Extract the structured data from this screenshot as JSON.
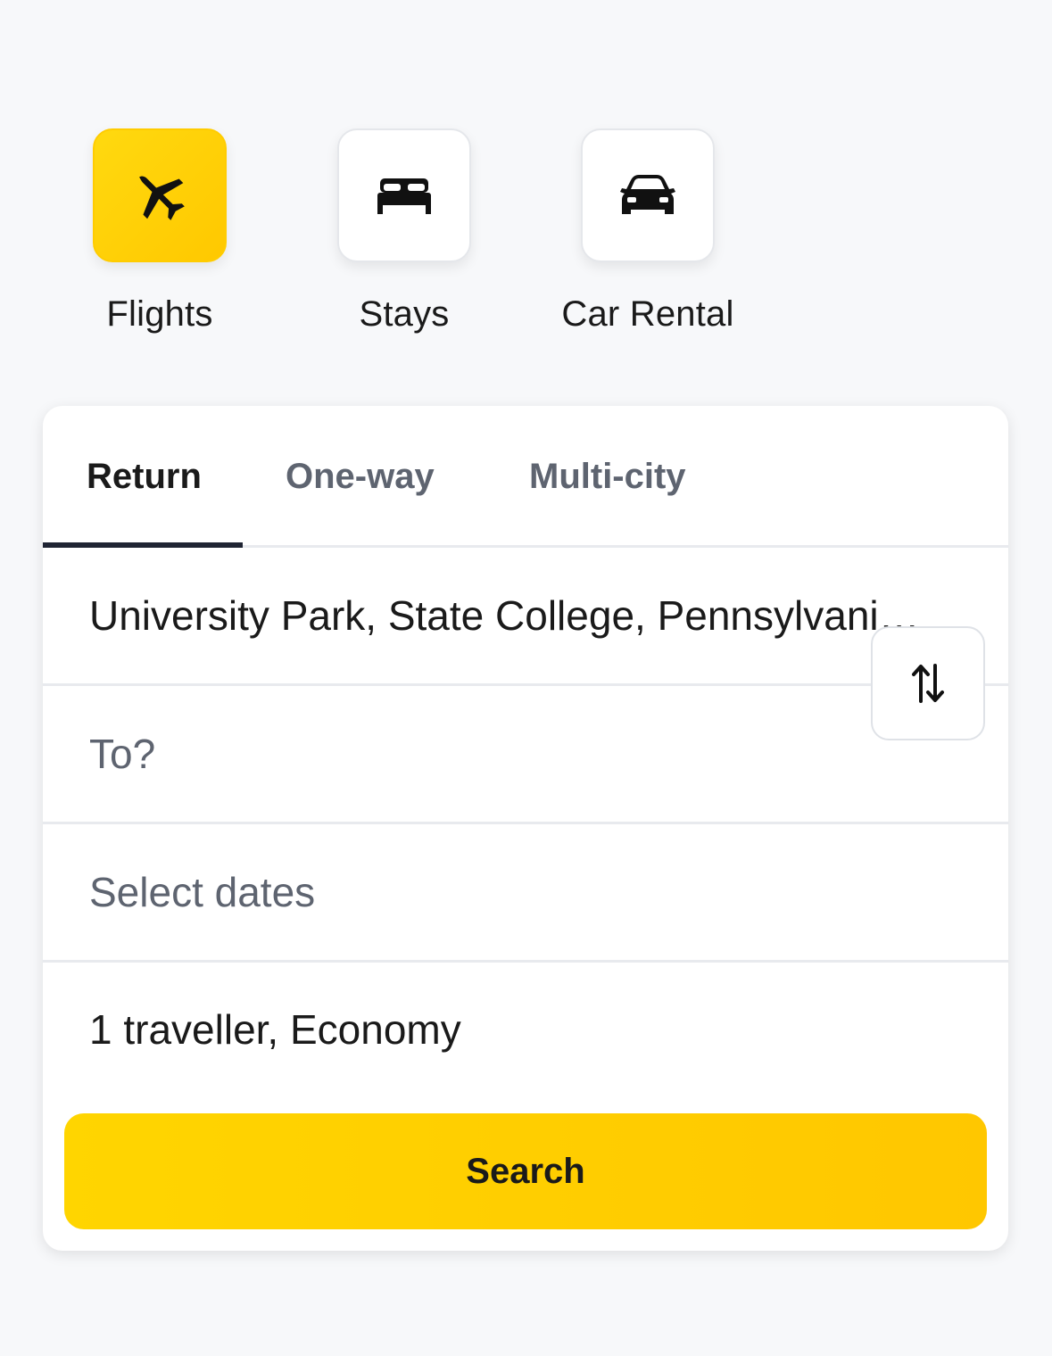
{
  "categories": [
    {
      "label": "Flights",
      "icon": "airplane-icon",
      "active": true
    },
    {
      "label": "Stays",
      "icon": "bed-icon",
      "active": false
    },
    {
      "label": "Car Rental",
      "icon": "car-icon",
      "active": false
    }
  ],
  "trip_tabs": [
    {
      "label": "Return",
      "active": true
    },
    {
      "label": "One-way",
      "active": false
    },
    {
      "label": "Multi-city",
      "active": false
    }
  ],
  "form": {
    "origin_value": "University Park, State College, Pennsylvania, ...",
    "destination_placeholder": "To?",
    "dates_placeholder": "Select dates",
    "travellers_value": "1 traveller, Economy",
    "swap_icon": "swap-vertical-icon"
  },
  "search_button": {
    "label": "Search"
  },
  "colors": {
    "accent": "#ffc800",
    "background": "#f7f8fa",
    "text_primary": "#1a1a1a",
    "text_secondary": "#5e6470"
  }
}
